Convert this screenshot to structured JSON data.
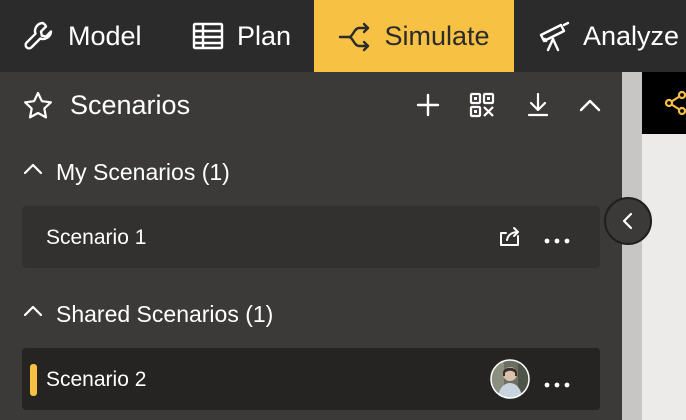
{
  "nav": {
    "tabs": [
      {
        "label": "Model",
        "icon": "wrench-icon"
      },
      {
        "label": "Plan",
        "icon": "table-icon"
      },
      {
        "label": "Simulate",
        "icon": "branch-arrow-icon",
        "active": true
      },
      {
        "label": "Analyze",
        "icon": "telescope-icon"
      }
    ]
  },
  "panel": {
    "title": "Scenarios",
    "title_icon": "star-icon",
    "actions": [
      "plus-icon",
      "qr-code-icon",
      "download-icon",
      "chevron-up-icon"
    ],
    "sections": [
      {
        "label": "My Scenarios (1)",
        "items": [
          {
            "label": "Scenario 1",
            "actions": [
              "share-icon",
              "more-icon"
            ]
          }
        ]
      },
      {
        "label": "Shared Scenarios (1)",
        "items": [
          {
            "label": "Scenario 2",
            "actions": [
              "avatar",
              "more-icon"
            ]
          }
        ]
      }
    ]
  },
  "colors": {
    "accent": "#f7c244",
    "nav_background": "#2b2b2b",
    "panel_background": "#3b3a39",
    "card_background": "#323130",
    "selected_card_background": "#252423"
  }
}
